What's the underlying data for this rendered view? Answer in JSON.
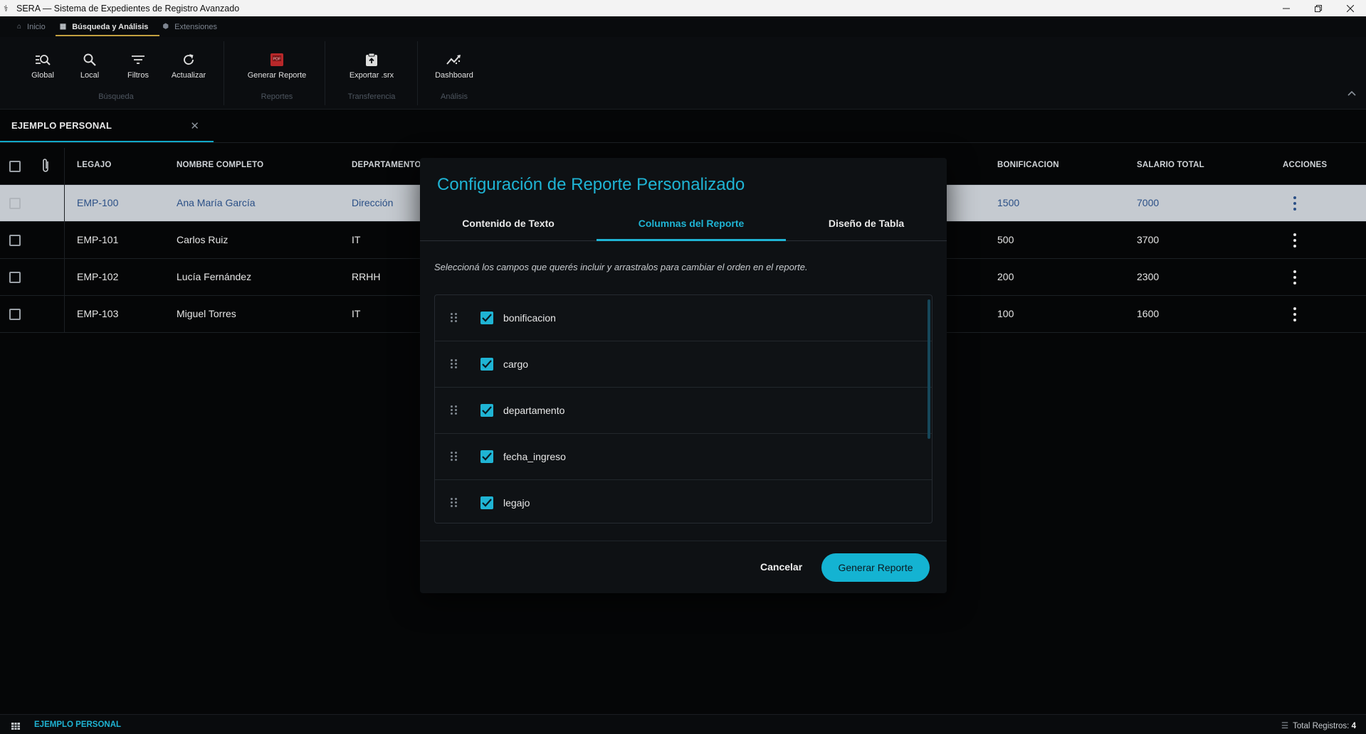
{
  "window": {
    "title": "SERA — Sistema de Expedientes de Registro Avanzado"
  },
  "topnav": {
    "tabs": [
      {
        "label": "Inicio",
        "icon": "home-icon"
      },
      {
        "label": "Búsqueda y Análisis",
        "icon": "table-icon",
        "active": true
      },
      {
        "label": "Extensiones",
        "icon": "puzzle-icon"
      }
    ]
  },
  "ribbon": {
    "groups": [
      {
        "label": "Búsqueda",
        "buttons": [
          "Global",
          "Local",
          "Filtros",
          "Actualizar"
        ]
      },
      {
        "label": "Reportes",
        "buttons": [
          "Generar Reporte"
        ]
      },
      {
        "label": "Transferencia",
        "buttons": [
          "Exportar .srx"
        ]
      },
      {
        "label": "Análisis",
        "buttons": [
          "Dashboard"
        ]
      }
    ]
  },
  "doc_tab": {
    "label": "EJEMPLO PERSONAL"
  },
  "table": {
    "headers": {
      "legajo": "LEGAJO",
      "nombre": "NOMBRE COMPLETO",
      "departamento": "DEPARTAMENTO",
      "bonificacion": "BONIFICACION",
      "salario": "SALARIO TOTAL",
      "acciones": "ACCIONES"
    },
    "rows": [
      {
        "legajo": "EMP-100",
        "nombre": "Ana María García",
        "departamento": "Dirección",
        "bonificacion": "1500",
        "salario": "7000",
        "selected": true
      },
      {
        "legajo": "EMP-101",
        "nombre": "Carlos Ruiz",
        "departamento": "IT",
        "bonificacion": "500",
        "salario": "3700"
      },
      {
        "legajo": "EMP-102",
        "nombre": "Lucía Fernández",
        "departamento": "RRHH",
        "bonificacion": "200",
        "salario": "2300"
      },
      {
        "legajo": "EMP-103",
        "nombre": "Miguel Torres",
        "departamento": "IT",
        "bonificacion": "100",
        "salario": "1600"
      }
    ]
  },
  "modal": {
    "title": "Configuración de Reporte Personalizado",
    "tabs": [
      "Contenido de Texto",
      "Columnas del Reporte",
      "Diseño de Tabla"
    ],
    "active_tab": "Columnas del Reporte",
    "hint": "Seleccioná los campos que querés incluir y arrastralos para cambiar el orden en el reporte.",
    "fields": [
      {
        "name": "bonificacion",
        "checked": true
      },
      {
        "name": "cargo",
        "checked": true
      },
      {
        "name": "departamento",
        "checked": true
      },
      {
        "name": "fecha_ingreso",
        "checked": true
      },
      {
        "name": "legajo",
        "checked": true
      }
    ],
    "cancel_label": "Cancelar",
    "submit_label": "Generar Reporte"
  },
  "statusbar": {
    "document": "EJEMPLO PERSONAL",
    "total_label": "Total Registros:",
    "total_value": "4"
  },
  "colors": {
    "accent": "#1fb4d4",
    "tab_underline": "#c2a040",
    "selected_row_bg": "#c5cad0",
    "background": "#050607"
  }
}
